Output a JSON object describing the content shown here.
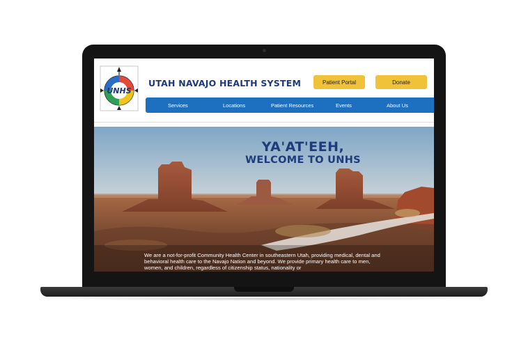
{
  "site": {
    "title": "UTAH NAVAJO HEALTH SYSTEM",
    "logo_text": "UNHS"
  },
  "header": {
    "patient_portal_label": "Patient Portal",
    "donate_label": "Donate"
  },
  "nav": {
    "items": [
      {
        "label": "Services"
      },
      {
        "label": "Locations"
      },
      {
        "label": "Patient Resources"
      },
      {
        "label": "Events"
      },
      {
        "label": "About Us"
      }
    ]
  },
  "hero": {
    "title_line1": "YA'AT'EEH,",
    "title_line2": "WELCOME TO UNHS",
    "body": "We are a not-for-profit Community Health Center in southeastern Utah, providing medical, dental and behavioral health care to the Navajo Nation and beyond. We provide primary health care to men, women, and children, regardless of citizenship status, nationality or"
  },
  "colors": {
    "brand_blue": "#1f3a78",
    "nav_blue": "#1d6fbf",
    "button_yellow": "#efc23a",
    "laptop_frame": "#141414"
  },
  "icons": {
    "logo": "unhs-medicine-wheel-logo"
  }
}
